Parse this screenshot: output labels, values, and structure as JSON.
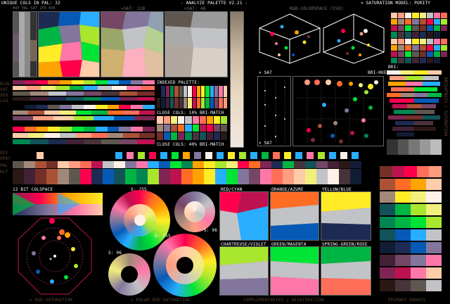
{
  "header": {
    "unique_cols": "UNIQUE COLS IN PAL: 32",
    "title": "- ANALYZE PALETTE V2.21 -",
    "sat_model": "× SATURATION MODEL: PURITY",
    "xsat_128": "×SAT: 128",
    "xsat_48": "×SAT: 48",
    "rgb_colorspace": "RGB-COLORSPACE (ISO)",
    "left_top_small": "HUE VAL SAT 255 096"
  },
  "labels": {
    "indexed_palette": "INDEXED PALETTE:",
    "close_cols_10": "CLOSE COLS: 10% BRI-MATCH",
    "close_cols_40": "CLOSE COLS: 40% BRI-MATCH",
    "x_sat": "× SAT",
    "bri_hue": "BRI-HUE",
    "x_sat2": "× SAT",
    "bri": "BRI:",
    "colspace_12bit": "12 BIT COLSPACE",
    "s255_a": "S: 255",
    "s96_a": "S: 96",
    "s96_b": "S: 96",
    "s255_b": "S: 255",
    "red_cyan": "RED/CYAN",
    "orange_azure": "ORANGE/AZURE",
    "yellow_blue": "YELLOW/BLUE",
    "chartreuse_violet": "CHARTREUSE/VIOLET",
    "green_magenta": "GREEN/MAGENTA",
    "spring_rose": "SPRING-GREEN/ROSE",
    "primary_ranges": "PRIMARY RANGES",
    "footer_hue_sat": "× HUE-SATURATION",
    "footer_polar": "× POLAR HUE-SATURATION",
    "footer_comp": "COMPLEMENTARIES / DESATURATION",
    "left_dev": "DEV",
    "left_gray": "GRAY",
    "left_pal": "PAL",
    "left_hlf": "HLF",
    "left_hcol": "HCOL",
    "left_sat": "SAT",
    "left_seq": "SEQ",
    "left_lsq": "LSQ",
    "right_vert": "BRIGHTNESS / SATURATION"
  },
  "palette": [
    "#000000",
    "#1d2b53",
    "#7e2553",
    "#008751",
    "#ab5236",
    "#5f574f",
    "#c2c3c7",
    "#fff1e8",
    "#ff004d",
    "#ffa300",
    "#ffec27",
    "#00e436",
    "#29adff",
    "#83769c",
    "#ff77a8",
    "#ffccaa",
    "#291814",
    "#111d35",
    "#422136",
    "#125359",
    "#742f29",
    "#49333b",
    "#a28879",
    "#f3ef7d",
    "#be1250",
    "#ff6c24",
    "#a8e72e",
    "#00b543",
    "#065ab5",
    "#754665",
    "#ff6e59",
    "#ff9d81"
  ],
  "accent_colors": {
    "label_white": "#ffffff",
    "label_brown": "#5a4535",
    "frame_gray": "#666666"
  }
}
